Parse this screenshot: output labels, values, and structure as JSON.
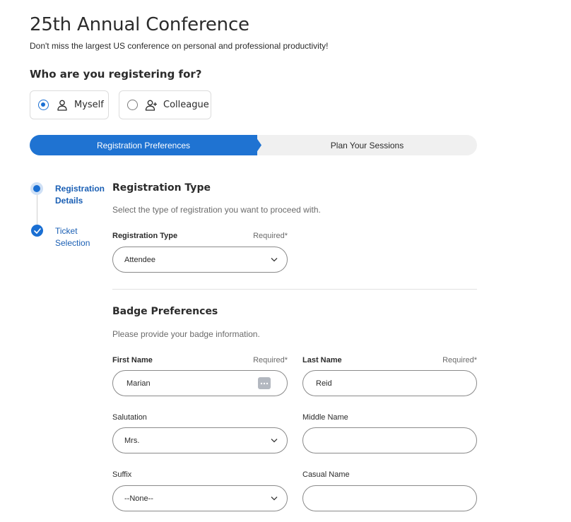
{
  "header": {
    "title": "25th Annual Conference",
    "subtitle": "Don't miss the largest US conference on personal and professional productivity!"
  },
  "registrant": {
    "question": "Who are you registering for?",
    "options": [
      {
        "label": "Myself",
        "selected": true,
        "icon": "person-icon"
      },
      {
        "label": "Colleague",
        "selected": false,
        "icon": "person-add-icon"
      }
    ]
  },
  "progress": {
    "steps": [
      {
        "label": "Registration Preferences",
        "active": true
      },
      {
        "label": "Plan Your Sessions",
        "active": false
      }
    ]
  },
  "sidebar": {
    "steps": [
      {
        "label": "Registration Details",
        "state": "current"
      },
      {
        "label": "Ticket Selection",
        "state": "done"
      }
    ]
  },
  "registration_type": {
    "title": "Registration Type",
    "description": "Select the type of registration you want to proceed with.",
    "field_label": "Registration Type",
    "required": "Required*",
    "value": "Attendee"
  },
  "badge": {
    "title": "Badge Preferences",
    "description": "Please provide your badge information.",
    "first_name": {
      "label": "First Name",
      "required": "Required*",
      "value": "Marian"
    },
    "last_name": {
      "label": "Last Name",
      "required": "Required*",
      "value": "Reid"
    },
    "salutation": {
      "label": "Salutation",
      "value": "Mrs."
    },
    "middle_name": {
      "label": "Middle Name",
      "value": ""
    },
    "suffix": {
      "label": "Suffix",
      "value": "--None--"
    },
    "casual_name": {
      "label": "Casual Name",
      "value": ""
    }
  },
  "colors": {
    "accent": "#1f73d2",
    "progress_inactive": "#f0f0f0",
    "step_label": "#1a5fb4"
  }
}
